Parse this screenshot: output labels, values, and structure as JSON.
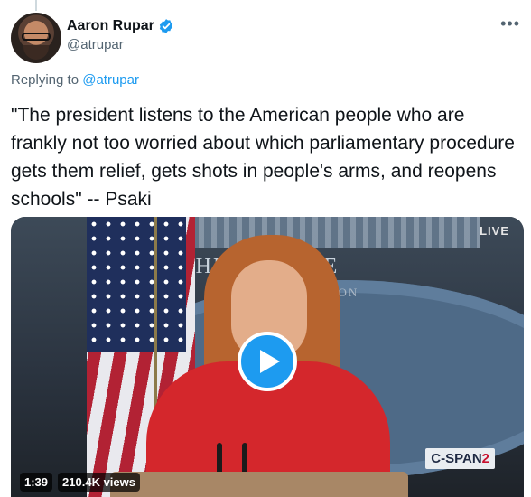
{
  "author": {
    "display_name": "Aaron Rupar",
    "handle": "@atrupar",
    "verified": true
  },
  "reply_context": {
    "prefix": "Replying to",
    "handle": "@atrupar"
  },
  "tweet": {
    "text": "\"The president listens to the American people who are frankly not too worried about which parliamentary procedure gets them relief, gets shots in people's arms, and reopens schools\" -- Psaki"
  },
  "video": {
    "live_label": "LIVE",
    "backdrop_text": "THE        E HOUSE",
    "backdrop_subtext": "NGTON",
    "network_logo_main": "C-SPAN",
    "network_logo_suffix": "2",
    "duration": "1:39",
    "views": "210.4K views"
  },
  "icons": {
    "verified": "verified-badge-icon",
    "more": "more-options-icon",
    "play": "play-icon"
  },
  "colors": {
    "accent": "#1d9bf0",
    "secondary_text": "#536471",
    "primary_text": "#0f1419"
  }
}
